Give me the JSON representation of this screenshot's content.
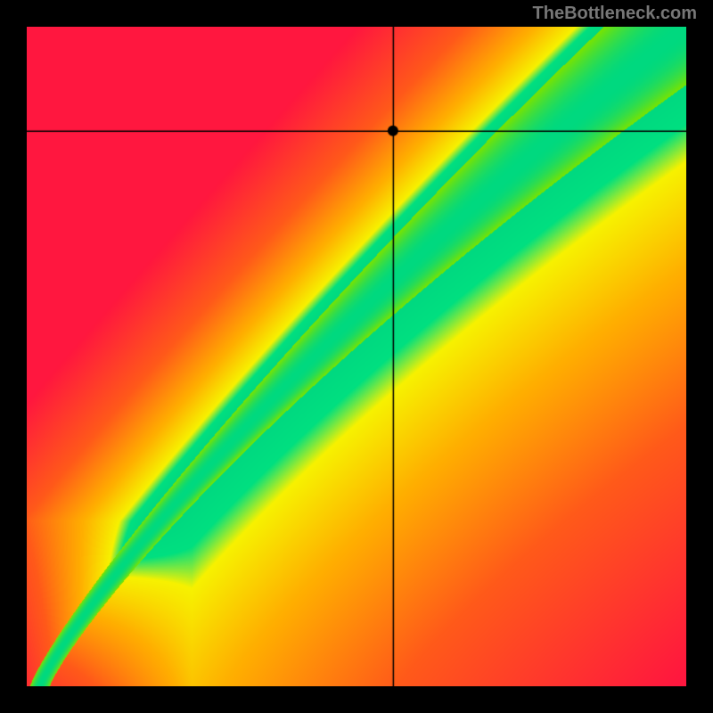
{
  "watermark": "TheBottleneck.com",
  "chart_data": {
    "type": "heatmap",
    "title": "",
    "xlabel": "",
    "ylabel": "",
    "xlim": [
      0,
      1
    ],
    "ylim": [
      0,
      1
    ],
    "legend": false,
    "marker": {
      "x": 0.556,
      "y": 0.842
    },
    "crosshair": {
      "x": 0.556,
      "y": 0.842
    },
    "ridge": {
      "description": "Diagonal optimal band (green) from lower-left to upper-right, roughly y = x^1.22 center line, widening toward the top.",
      "color_stops": [
        {
          "dist": 0.0,
          "color": "#00d980"
        },
        {
          "dist": 0.05,
          "color": "#00e080"
        },
        {
          "dist": 0.1,
          "color": "#f7f200"
        },
        {
          "dist": 0.25,
          "color": "#ffb000"
        },
        {
          "dist": 0.5,
          "color": "#ff5a1a"
        },
        {
          "dist": 0.9,
          "color": "#ff173f"
        }
      ]
    },
    "corner_colors": {
      "bottom_left": "#ff173f",
      "top_left": "#ff173f",
      "bottom_right": "#ff173f",
      "top_right": "#f5ec00",
      "center_band": "#00d980"
    },
    "sampled_grid": {
      "note": "10x10 grid of estimated colors (row 0 = bottom of image y=0, col 0 = left x=0)",
      "colors": [
        [
          "#ff2a30",
          "#ff4a20",
          "#ff6a18",
          "#ff8a15",
          "#ffa812",
          "#ffc010",
          "#ffd60e",
          "#ffe80c",
          "#fff40a",
          "#fffc08"
        ],
        [
          "#ff2235",
          "#ff2a30",
          "#ff5020",
          "#ff7018",
          "#ff9015",
          "#ffaa12",
          "#ffc410",
          "#ffdc0e",
          "#ffee0c",
          "#fff80a"
        ],
        [
          "#ff1c3a",
          "#ff2235",
          "#ff2a30",
          "#ff5520",
          "#ff7818",
          "#ff9615",
          "#ffb212",
          "#ffce10",
          "#ffe60e",
          "#fff40c"
        ],
        [
          "#ff183d",
          "#ff1c3a",
          "#ff2235",
          "#f6e000",
          "#ff5a20",
          "#ff8018",
          "#ff9e15",
          "#ffba12",
          "#ffd610",
          "#ffec0e"
        ],
        [
          "#ff163f",
          "#ff183d",
          "#ff1c3a",
          "#c0e500",
          "#06d980",
          "#ff6020",
          "#ff8818",
          "#ffa615",
          "#ffc412",
          "#ffde10"
        ],
        [
          "#ff163f",
          "#ff163f",
          "#ff183d",
          "#ff6a18",
          "#8ae200",
          "#06d980",
          "#ff6820",
          "#ff9018",
          "#ffb015",
          "#ffcc12"
        ],
        [
          "#ff163f",
          "#ff163f",
          "#ff163f",
          "#ff4022",
          "#ffb012",
          "#4ee000",
          "#06d980",
          "#ff7020",
          "#ff9818",
          "#ffba15"
        ],
        [
          "#ff163f",
          "#ff163f",
          "#ff163f",
          "#ff2a30",
          "#ff7818",
          "#ffd010",
          "#2de000",
          "#06d980",
          "#ff7a20",
          "#ffa218"
        ],
        [
          "#ff163f",
          "#ff163f",
          "#ff163f",
          "#ff1c3a",
          "#ff5020",
          "#ffa015",
          "#f0ea00",
          "#06d980",
          "#3de200",
          "#ff8820"
        ],
        [
          "#ff163f",
          "#ff163f",
          "#ff163f",
          "#ff183d",
          "#ff3028",
          "#ff7018",
          "#ffc012",
          "#c0ea00",
          "#06d980",
          "#4ae400"
        ]
      ]
    }
  }
}
